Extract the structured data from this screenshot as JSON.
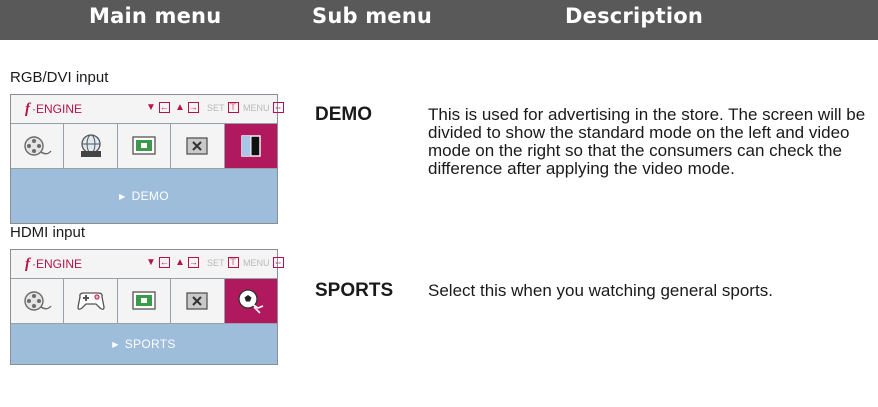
{
  "header": {
    "main": "Main menu",
    "sub": "Sub menu",
    "description": "Description"
  },
  "sections": [
    {
      "label": "RGB/DVI input",
      "osd": {
        "engine_label": "ENGINE",
        "set_label": "SET",
        "menu_label": "MENU",
        "selected_item": "DEMO",
        "active_tile": 5
      },
      "term": "DEMO",
      "description": "This is used for advertising in the store. The screen will be divided to show the standard mode on the left and video mode on the right so that the consumers can check the difference after applying the video mode."
    },
    {
      "label": "HDMI input",
      "osd": {
        "engine_label": "ENGINE",
        "set_label": "SET",
        "menu_label": "MENU",
        "selected_item": "SPORTS",
        "active_tile": 5
      },
      "term": "SPORTS",
      "description": "Select this when you watching general sports."
    }
  ],
  "colors": {
    "header_bg": "#595959",
    "accent": "#b0195d",
    "osd_bottom": "#9ebddb"
  }
}
